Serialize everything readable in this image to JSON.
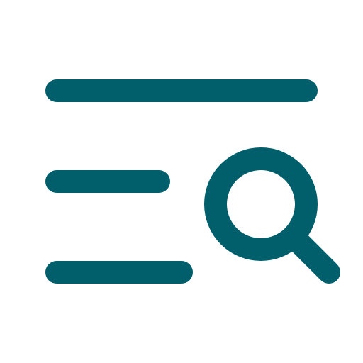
{
  "icon": {
    "name": "list-search-icon",
    "color": "#005f6b",
    "background": "#ffffff"
  }
}
